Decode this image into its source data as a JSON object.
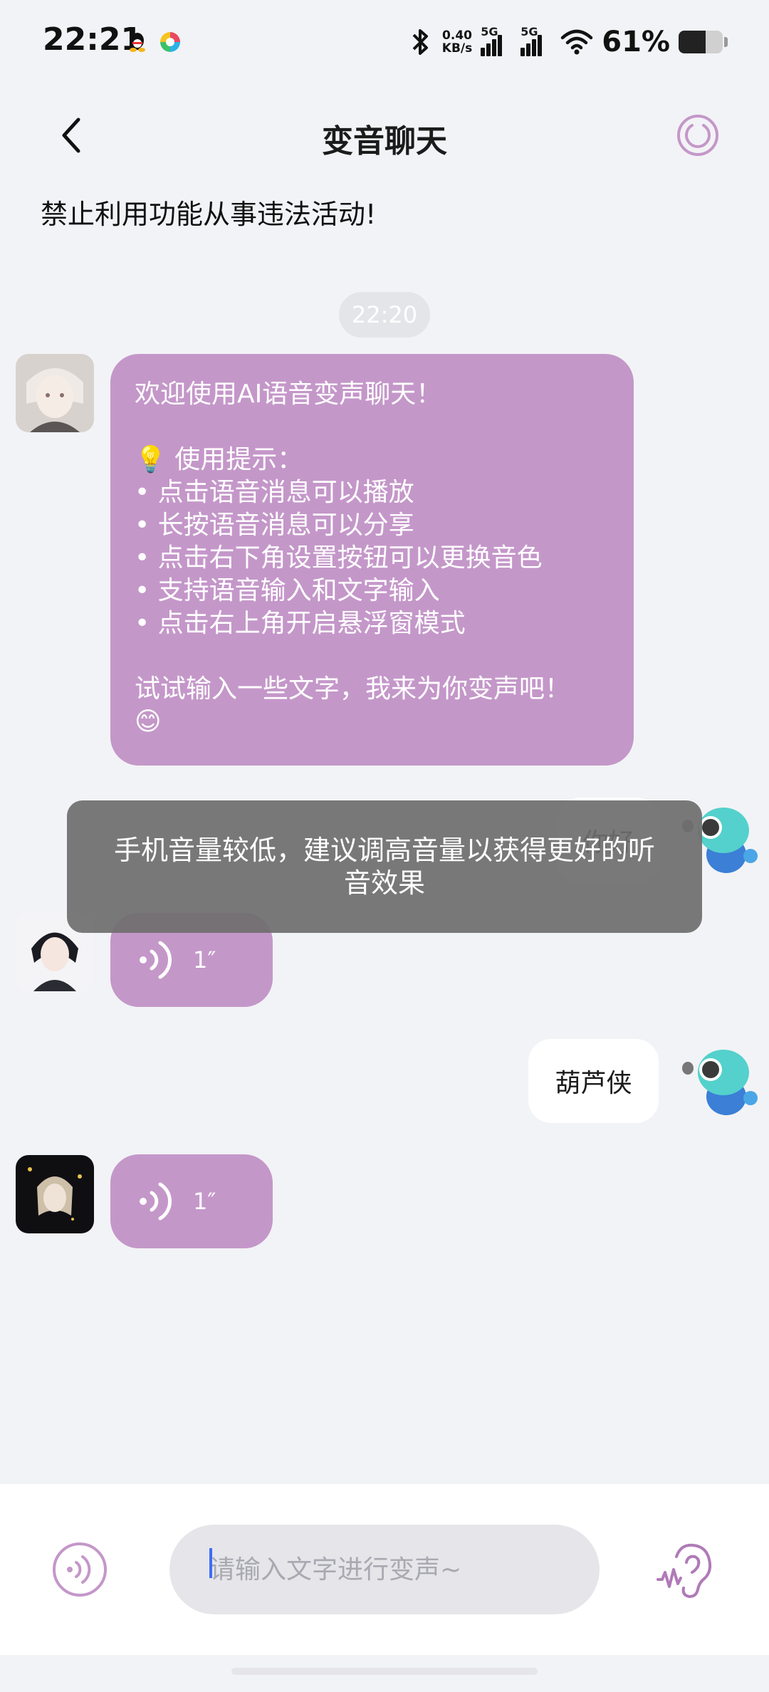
{
  "status_bar": {
    "time": "22:21",
    "net_speed_value": "0.40",
    "net_speed_unit": "KB/s",
    "sim1": "5G",
    "sim2": "5G",
    "battery_pct": "61%",
    "battery_level": 0.61,
    "icons": [
      "qq-icon",
      "app-notification-icon",
      "bluetooth-icon",
      "signal-icon",
      "signal-icon",
      "wifi-icon",
      "battery-icon"
    ]
  },
  "header": {
    "back_icon": "chevron-left-icon",
    "title": "变音聊天",
    "float_icon": "floating-window-icon"
  },
  "warning": "禁止利用功能从事违法活动!",
  "timestamp": "22:20",
  "welcome_message": {
    "greeting": "欢迎使用AI语音变声聊天！",
    "tips_title": "💡 使用提示：",
    "tips": [
      "• 点击语音消息可以播放",
      "• 长按语音消息可以分享",
      "• 点击右下角设置按钮可以更换音色",
      "• 支持语音输入和文字输入",
      "• 点击右上角开启悬浮窗模式"
    ],
    "closing": "试试输入一些文字，我来为你变声吧！",
    "emoji": "😊"
  },
  "messages": [
    {
      "from": "me",
      "text": "你好"
    },
    {
      "from": "ai",
      "type": "voice",
      "duration": "1″"
    },
    {
      "from": "me",
      "text": "葫芦侠"
    },
    {
      "from": "ai",
      "type": "voice",
      "duration": "1″"
    }
  ],
  "toast": "手机音量较低，建议调高音量以获得更好的听音效果",
  "input": {
    "placeholder": "请输入文字进行变声~",
    "voice_icon": "voice-input-icon",
    "ear_icon": "ear-settings-icon"
  },
  "colors": {
    "accent": "#c497c9",
    "background": "#f2f3f6",
    "toast": "#6e6e6e"
  }
}
